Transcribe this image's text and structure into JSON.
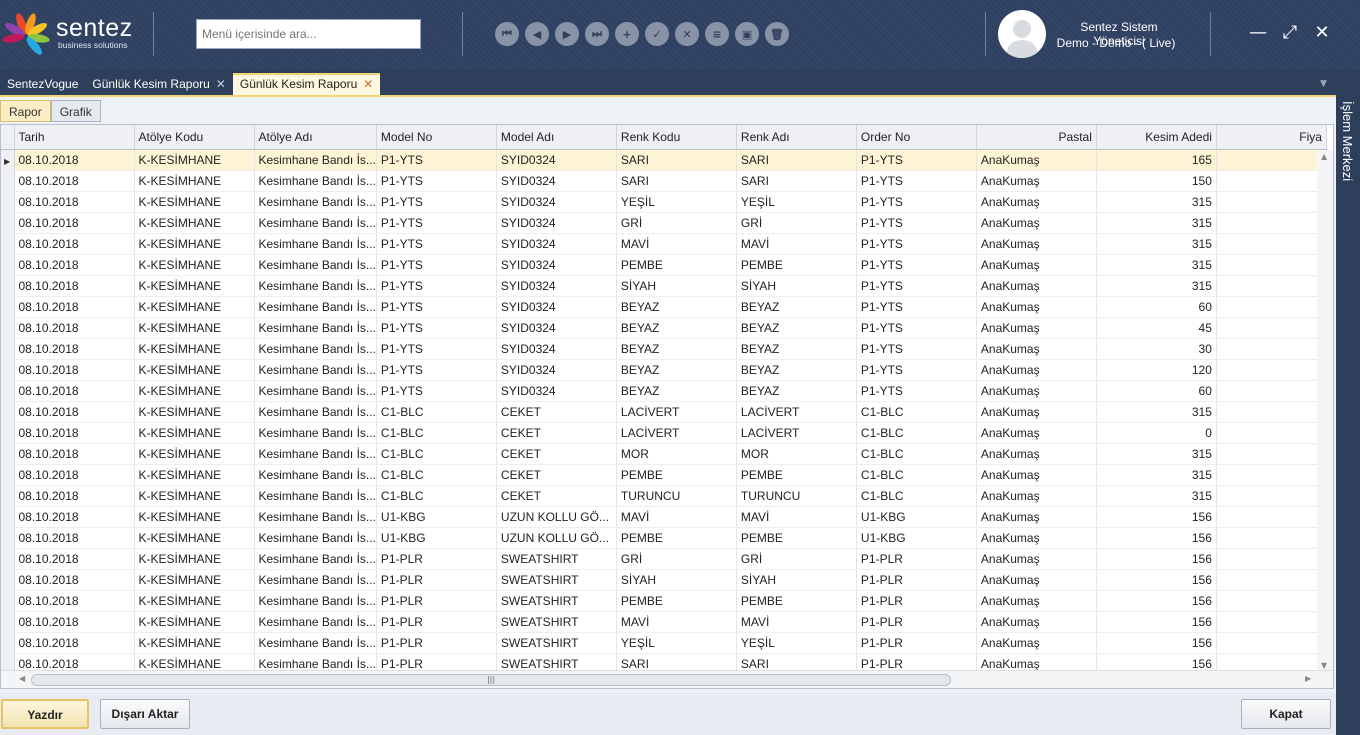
{
  "header": {
    "logo_word": "sentez",
    "logo_sub": "business solutions",
    "search_placeholder": "Menü içerisinde ara...",
    "toolbar_icons": [
      "first-icon",
      "previous-icon",
      "next-icon",
      "last-icon",
      "add-icon",
      "approve-icon",
      "cancel-icon",
      "list-icon",
      "export-icon",
      "delete-icon"
    ],
    "user_name": "Sentez Sistem Yöneticisi",
    "user_company": "Demo - Demo - ( Live)",
    "minimize_glyph": "—",
    "maximize_glyph": "⤢",
    "close_glyph": "✕"
  },
  "tabs": [
    {
      "label": "SentezVogue",
      "closable": false,
      "active": false
    },
    {
      "label": "Günlük Kesim Raporu",
      "closable": true,
      "active": false
    },
    {
      "label": "Günlük Kesim Raporu",
      "closable": true,
      "active": true
    }
  ],
  "subtabs": [
    {
      "label": "Rapor",
      "active": true
    },
    {
      "label": "Grafik",
      "active": false
    }
  ],
  "grid": {
    "columns": [
      "Tarih",
      "Atölye Kodu",
      "Atölye Adı",
      "Model No",
      "Model Adı",
      "Renk Kodu",
      "Renk Adı",
      "Order No",
      "Pastal",
      "Kesim Adedi",
      "Fiya"
    ],
    "rows": [
      [
        "08.10.2018",
        "K-KESİMHANE",
        "Kesimhane Bandı İs...",
        "P1-YTS",
        "SYID0324",
        "SARI",
        "SARI",
        "P1-YTS",
        "AnaKumaş",
        "165"
      ],
      [
        "08.10.2018",
        "K-KESİMHANE",
        "Kesimhane Bandı İs...",
        "P1-YTS",
        "SYID0324",
        "SARI",
        "SARI",
        "P1-YTS",
        "AnaKumaş",
        "150"
      ],
      [
        "08.10.2018",
        "K-KESİMHANE",
        "Kesimhane Bandı İs...",
        "P1-YTS",
        "SYID0324",
        "YEŞİL",
        "YEŞİL",
        "P1-YTS",
        "AnaKumaş",
        "315"
      ],
      [
        "08.10.2018",
        "K-KESİMHANE",
        "Kesimhane Bandı İs...",
        "P1-YTS",
        "SYID0324",
        "GRİ",
        "GRİ",
        "P1-YTS",
        "AnaKumaş",
        "315"
      ],
      [
        "08.10.2018",
        "K-KESİMHANE",
        "Kesimhane Bandı İs...",
        "P1-YTS",
        "SYID0324",
        "MAVİ",
        "MAVİ",
        "P1-YTS",
        "AnaKumaş",
        "315"
      ],
      [
        "08.10.2018",
        "K-KESİMHANE",
        "Kesimhane Bandı İs...",
        "P1-YTS",
        "SYID0324",
        "PEMBE",
        "PEMBE",
        "P1-YTS",
        "AnaKumaş",
        "315"
      ],
      [
        "08.10.2018",
        "K-KESİMHANE",
        "Kesimhane Bandı İs...",
        "P1-YTS",
        "SYID0324",
        "SİYAH",
        "SİYAH",
        "P1-YTS",
        "AnaKumaş",
        "315"
      ],
      [
        "08.10.2018",
        "K-KESİMHANE",
        "Kesimhane Bandı İs...",
        "P1-YTS",
        "SYID0324",
        "BEYAZ",
        "BEYAZ",
        "P1-YTS",
        "AnaKumaş",
        "60"
      ],
      [
        "08.10.2018",
        "K-KESİMHANE",
        "Kesimhane Bandı İs...",
        "P1-YTS",
        "SYID0324",
        "BEYAZ",
        "BEYAZ",
        "P1-YTS",
        "AnaKumaş",
        "45"
      ],
      [
        "08.10.2018",
        "K-KESİMHANE",
        "Kesimhane Bandı İs...",
        "P1-YTS",
        "SYID0324",
        "BEYAZ",
        "BEYAZ",
        "P1-YTS",
        "AnaKumaş",
        "30"
      ],
      [
        "08.10.2018",
        "K-KESİMHANE",
        "Kesimhane Bandı İs...",
        "P1-YTS",
        "SYID0324",
        "BEYAZ",
        "BEYAZ",
        "P1-YTS",
        "AnaKumaş",
        "120"
      ],
      [
        "08.10.2018",
        "K-KESİMHANE",
        "Kesimhane Bandı İs...",
        "P1-YTS",
        "SYID0324",
        "BEYAZ",
        "BEYAZ",
        "P1-YTS",
        "AnaKumaş",
        "60"
      ],
      [
        "08.10.2018",
        "K-KESİMHANE",
        "Kesimhane Bandı İs...",
        "C1-BLC",
        "CEKET",
        "LACİVERT",
        "LACİVERT",
        "C1-BLC",
        "AnaKumaş",
        "315"
      ],
      [
        "08.10.2018",
        "K-KESİMHANE",
        "Kesimhane Bandı İs...",
        "C1-BLC",
        "CEKET",
        "LACİVERT",
        "LACİVERT",
        "C1-BLC",
        "AnaKumaş",
        "0"
      ],
      [
        "08.10.2018",
        "K-KESİMHANE",
        "Kesimhane Bandı İs...",
        "C1-BLC",
        "CEKET",
        "MOR",
        "MOR",
        "C1-BLC",
        "AnaKumaş",
        "315"
      ],
      [
        "08.10.2018",
        "K-KESİMHANE",
        "Kesimhane Bandı İs...",
        "C1-BLC",
        "CEKET",
        "PEMBE",
        "PEMBE",
        "C1-BLC",
        "AnaKumaş",
        "315"
      ],
      [
        "08.10.2018",
        "K-KESİMHANE",
        "Kesimhane Bandı İs...",
        "C1-BLC",
        "CEKET",
        "TURUNCU",
        "TURUNCU",
        "C1-BLC",
        "AnaKumaş",
        "315"
      ],
      [
        "08.10.2018",
        "K-KESİMHANE",
        "Kesimhane Bandı İs...",
        "U1-KBG",
        "UZUN KOLLU GÖ...",
        "MAVİ",
        "MAVİ",
        "U1-KBG",
        "AnaKumaş",
        "156"
      ],
      [
        "08.10.2018",
        "K-KESİMHANE",
        "Kesimhane Bandı İs...",
        "U1-KBG",
        "UZUN KOLLU GÖ...",
        "PEMBE",
        "PEMBE",
        "U1-KBG",
        "AnaKumaş",
        "156"
      ],
      [
        "08.10.2018",
        "K-KESİMHANE",
        "Kesimhane Bandı İs...",
        "P1-PLR",
        "SWEATSHIRT",
        "GRİ",
        "GRİ",
        "P1-PLR",
        "AnaKumaş",
        "156"
      ],
      [
        "08.10.2018",
        "K-KESİMHANE",
        "Kesimhane Bandı İs...",
        "P1-PLR",
        "SWEATSHIRT",
        "SİYAH",
        "SİYAH",
        "P1-PLR",
        "AnaKumaş",
        "156"
      ],
      [
        "08.10.2018",
        "K-KESİMHANE",
        "Kesimhane Bandı İs...",
        "P1-PLR",
        "SWEATSHIRT",
        "PEMBE",
        "PEMBE",
        "P1-PLR",
        "AnaKumaş",
        "156"
      ],
      [
        "08.10.2018",
        "K-KESİMHANE",
        "Kesimhane Bandı İs...",
        "P1-PLR",
        "SWEATSHIRT",
        "MAVİ",
        "MAVİ",
        "P1-PLR",
        "AnaKumaş",
        "156"
      ],
      [
        "08.10.2018",
        "K-KESİMHANE",
        "Kesimhane Bandı İs...",
        "P1-PLR",
        "SWEATSHIRT",
        "YEŞİL",
        "YEŞİL",
        "P1-PLR",
        "AnaKumaş",
        "156"
      ],
      [
        "08.10.2018",
        "K-KESİMHANE",
        "Kesimhane Bandı İs...",
        "P1-PLR",
        "SWEATSHIRT",
        "SARI",
        "SARI",
        "P1-PLR",
        "AnaKumaş",
        "156"
      ]
    ],
    "selected_row": 0
  },
  "footer": {
    "print_label": "Yazdır",
    "export_label": "Dışarı Aktar",
    "close_label": "Kapat"
  },
  "side_panel": {
    "label": "İşlem Merkezi"
  },
  "colors": {
    "header_bg": "#2f405d",
    "accent": "#f1d476",
    "selected_row": "#fdf4d6"
  }
}
